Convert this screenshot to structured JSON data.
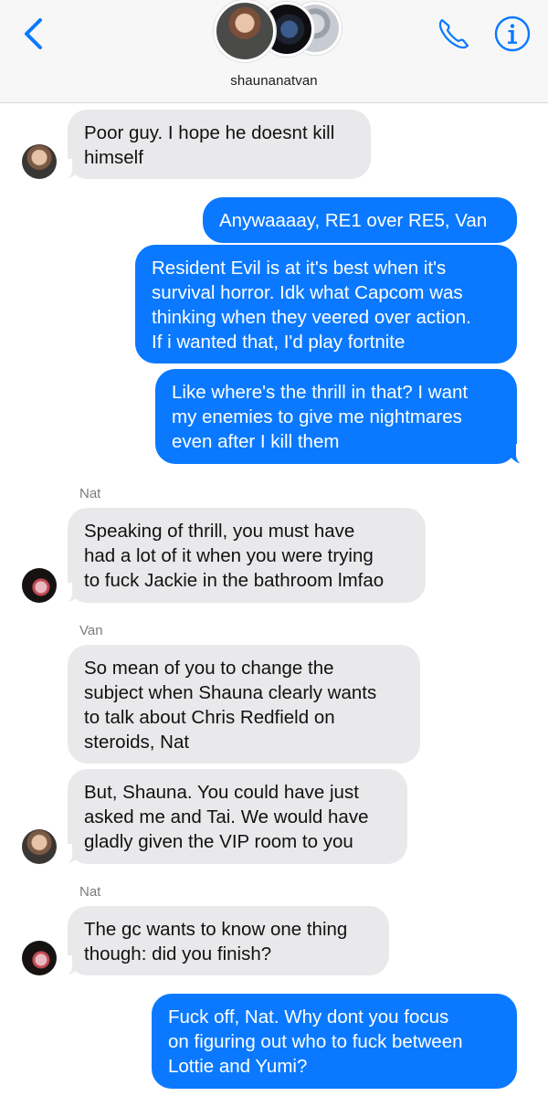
{
  "header": {
    "contact_name": "shaunanatvan"
  },
  "messages": [
    {
      "id": 1,
      "direction": "incoming",
      "avatar": "shauna",
      "text_lines": [
        "Poor guy. I hope he doesnt kill",
        "himself"
      ]
    },
    {
      "id": 2,
      "direction": "outgoing",
      "text_lines": [
        "Anywaaaay, RE1 over RE5, Van"
      ]
    },
    {
      "id": 3,
      "direction": "outgoing",
      "text_lines": [
        "Resident Evil is at it's best when it's",
        "survival horror. Idk what Capcom was",
        "thinking when they veered over action.",
        "If i wanted that, I'd play fortnite"
      ]
    },
    {
      "id": 4,
      "direction": "outgoing",
      "text_lines": [
        "Like where's the thrill in that? I want",
        "my enemies to give me nightmares",
        "even after I kill them"
      ]
    },
    {
      "id": 5,
      "direction": "incoming",
      "sender": "Nat",
      "avatar": "nat",
      "text_lines": [
        "Speaking of thrill, you must have",
        "had a lot of it when you were trying",
        "to fuck Jackie in the bathroom lmfao"
      ]
    },
    {
      "id": 6,
      "direction": "incoming",
      "sender": "Van",
      "text_lines": [
        "So mean of you to change the",
        "subject when Shauna clearly wants",
        "to talk about Chris Redfield on",
        "steroids, Nat"
      ]
    },
    {
      "id": 7,
      "direction": "incoming",
      "avatar": "shauna",
      "text_lines": [
        "But, Shauna. You could have just",
        "asked me and Tai. We would have",
        "gladly given the VIP room to you"
      ]
    },
    {
      "id": 8,
      "direction": "incoming",
      "sender": "Nat",
      "avatar": "nat",
      "text_lines": [
        "The gc wants to know one thing",
        "though: did you finish?"
      ]
    },
    {
      "id": 9,
      "direction": "outgoing",
      "text_lines": [
        "Fuck off, Nat. Why dont you focus",
        "on figuring out who to fuck between",
        "Lottie and Yumi?"
      ]
    }
  ],
  "colors": {
    "outgoing_bubble": "#0a79ff",
    "incoming_bubble": "#e9e9eb",
    "accent": "#0a79ff"
  },
  "icons": [
    "back-chevron-icon",
    "phone-icon",
    "info-icon"
  ]
}
